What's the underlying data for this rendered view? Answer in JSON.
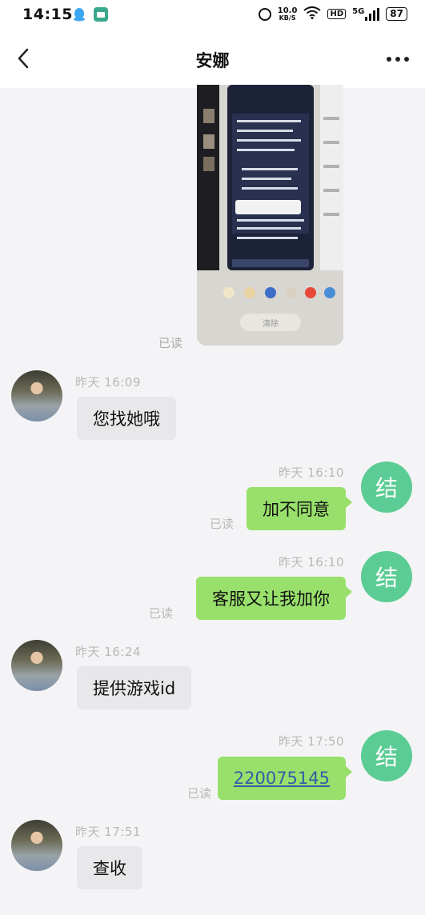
{
  "status_bar": {
    "time": "14:15",
    "network_speed_value": "10.0",
    "network_speed_unit": "KB/S",
    "hd_label": "HD",
    "signal_label": "5G",
    "battery": "87"
  },
  "header": {
    "title": "安娜"
  },
  "image_message": {
    "read_label": "已读",
    "inner_button": "清除"
  },
  "messages": [
    {
      "side": "in",
      "time": "昨天 16:09",
      "text": "您找她哦"
    },
    {
      "side": "out",
      "time": "昨天 16:10",
      "text": "加不同意",
      "read": "已读",
      "avatar": "结"
    },
    {
      "side": "out",
      "time": "昨天 16:10",
      "text": "客服又让我加你",
      "read": "已读",
      "avatar": "结"
    },
    {
      "side": "in",
      "time": "昨天 16:24",
      "text": "提供游戏id"
    },
    {
      "side": "out",
      "time": "昨天 17:50",
      "text": "220075145",
      "read": "已读",
      "avatar": "结"
    },
    {
      "side": "in",
      "time": "昨天 17:51",
      "text": "查收"
    }
  ],
  "colors": {
    "self_bubble": "#98e06b",
    "other_bubble": "#e8e8ea",
    "self_avatar": "#5ccc95",
    "link": "#2f5fa8"
  }
}
